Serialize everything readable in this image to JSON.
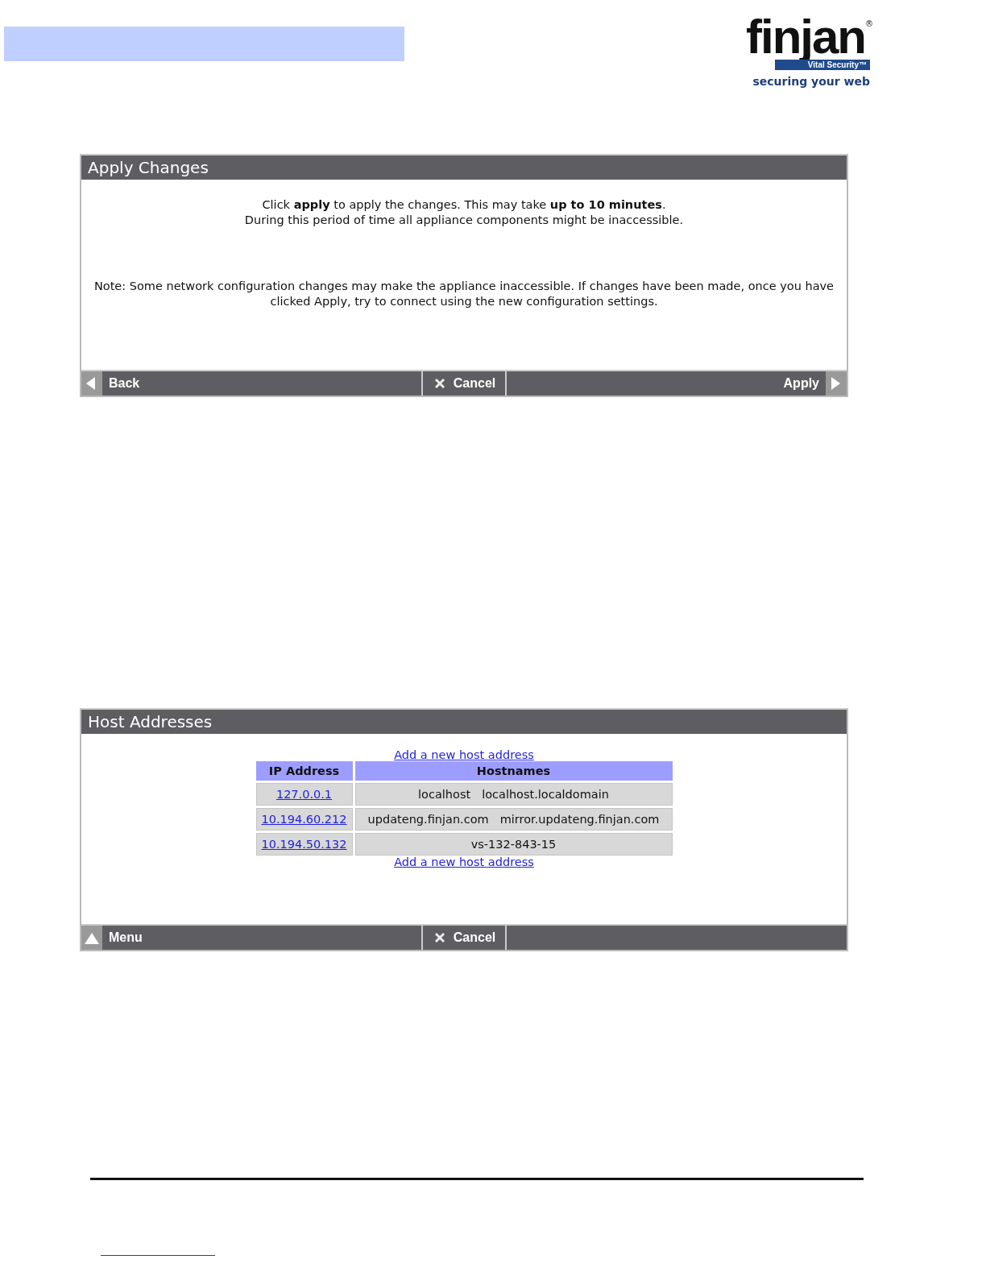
{
  "logo": {
    "wordmark": "finjan",
    "registered": "®",
    "badge": "Vital Security™",
    "tagline": "securing your web"
  },
  "panels": [
    {
      "title": "Apply Changes",
      "kind": "message",
      "paragraphs": [
        "Click **apply** to apply the changes. This may take **up to 10 minutes**.\nDuring this period of time all appliance components might be inaccessible.",
        "Note: Some network configuration changes may make the appliance inaccessible. If changes have been made, once you have clicked Apply, try to connect using the new configuration settings."
      ],
      "footer": [
        {
          "label": "Back",
          "kind": "back"
        },
        {
          "label": "Cancel",
          "kind": "cancel"
        },
        {
          "label": "Apply",
          "kind": "apply"
        }
      ]
    },
    {
      "title": "Host Addresses",
      "kind": "table",
      "add_link_top": "Add a new host address",
      "columns": [
        "IP Address",
        "Hostnames"
      ],
      "rows": [
        {
          "ip": "127.0.0.1",
          "hostnames": [
            "localhost",
            "localhost.localdomain"
          ]
        },
        {
          "ip": "10.194.60.212",
          "hostnames": [
            "updateng.finjan.com",
            "mirror.updateng.finjan.com"
          ]
        },
        {
          "ip": "10.194.50.132",
          "hostnames": [
            "vs-132-843-15"
          ]
        }
      ],
      "add_link_bottom": "Add a new host address",
      "footer": [
        {
          "label": "Menu",
          "kind": "menu"
        },
        {
          "label": "Cancel",
          "kind": "cancel"
        }
      ]
    }
  ]
}
